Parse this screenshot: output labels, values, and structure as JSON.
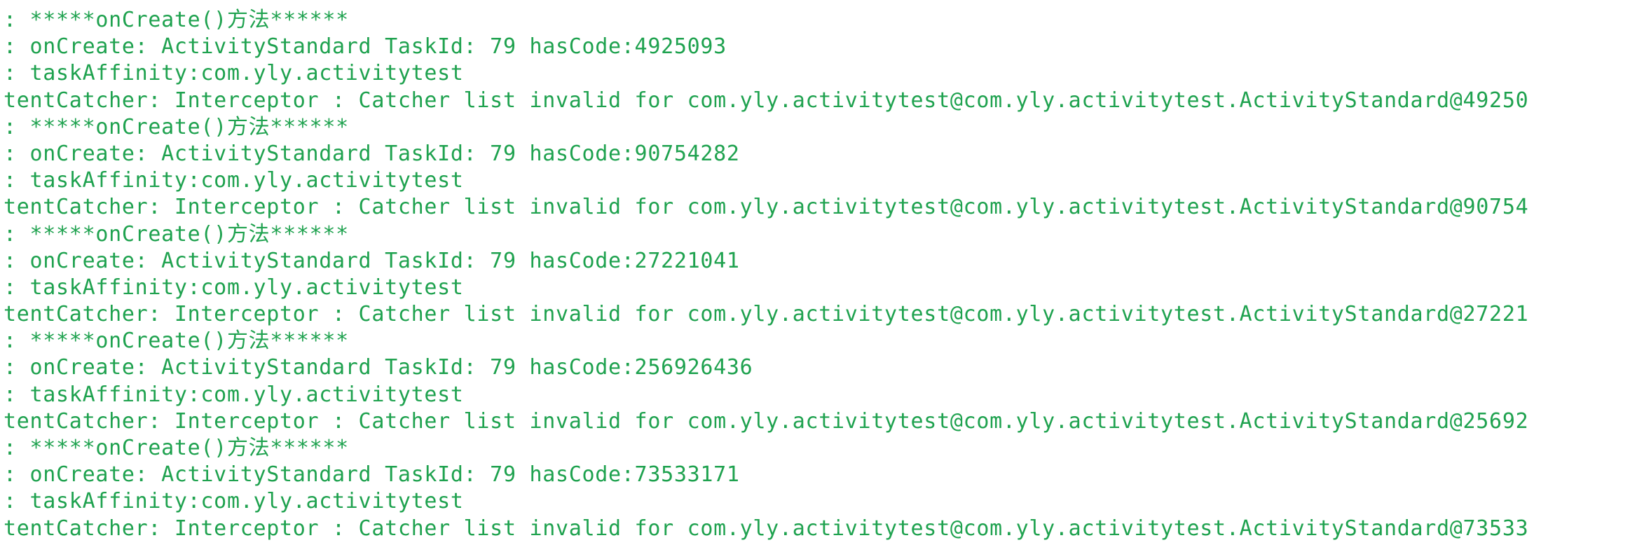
{
  "log": {
    "lines": [
      ": *****onCreate()方法******",
      ": onCreate: ActivityStandard TaskId: 79 hasCode:4925093",
      ": taskAffinity:com.yly.activitytest",
      "tentCatcher: Interceptor : Catcher list invalid for com.yly.activitytest@com.yly.activitytest.ActivityStandard@49250",
      ": *****onCreate()方法******",
      ": onCreate: ActivityStandard TaskId: 79 hasCode:90754282",
      ": taskAffinity:com.yly.activitytest",
      "tentCatcher: Interceptor : Catcher list invalid for com.yly.activitytest@com.yly.activitytest.ActivityStandard@90754",
      ": *****onCreate()方法******",
      ": onCreate: ActivityStandard TaskId: 79 hasCode:27221041",
      ": taskAffinity:com.yly.activitytest",
      "tentCatcher: Interceptor : Catcher list invalid for com.yly.activitytest@com.yly.activitytest.ActivityStandard@27221",
      ": *****onCreate()方法******",
      ": onCreate: ActivityStandard TaskId: 79 hasCode:256926436",
      ": taskAffinity:com.yly.activitytest",
      "tentCatcher: Interceptor : Catcher list invalid for com.yly.activitytest@com.yly.activitytest.ActivityStandard@25692",
      ": *****onCreate()方法******",
      ": onCreate: ActivityStandard TaskId: 79 hasCode:73533171",
      ": taskAffinity:com.yly.activitytest",
      "tentCatcher: Interceptor : Catcher list invalid for com.yly.activitytest@com.yly.activitytest.ActivityStandard@73533"
    ]
  },
  "colors": {
    "text": "#1fa24f",
    "background": "#ffffff"
  }
}
